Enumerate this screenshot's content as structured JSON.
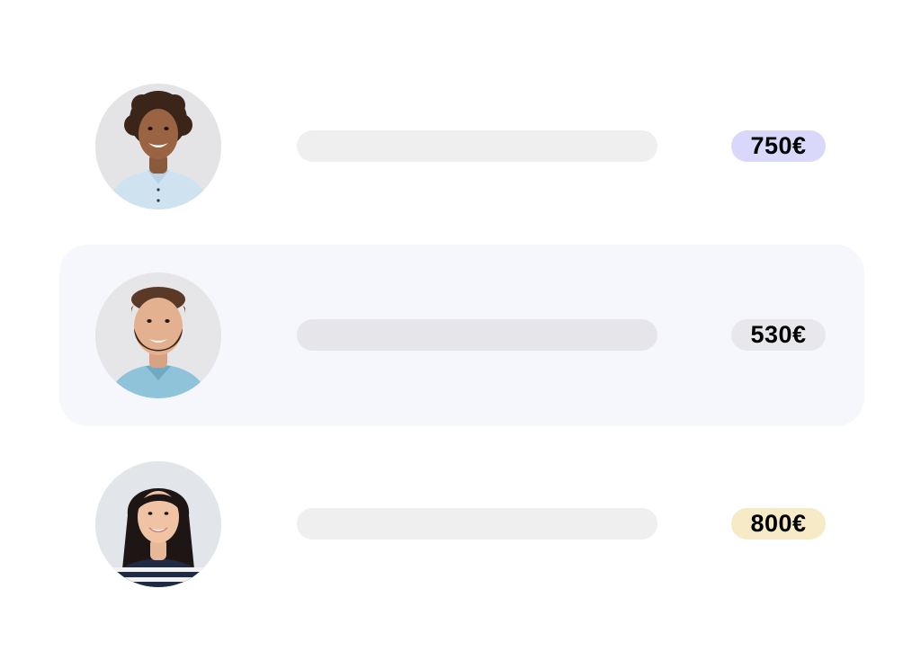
{
  "rows": [
    {
      "person": "avatar-man-curly-hair",
      "amount": "750€",
      "badge_color": "#d9d8fb",
      "highlighted": false
    },
    {
      "person": "avatar-man-beard",
      "amount": "530€",
      "badge_color": "#e8e8ec",
      "highlighted": true
    },
    {
      "person": "avatar-woman-long-hair",
      "amount": "800€",
      "badge_color": "#f6ebc6",
      "highlighted": false
    }
  ],
  "colors": {
    "row_highlight": "#f6f7fc",
    "placeholder_bar": "#efefef",
    "placeholder_bar_highlight": "#e6e6ea"
  }
}
